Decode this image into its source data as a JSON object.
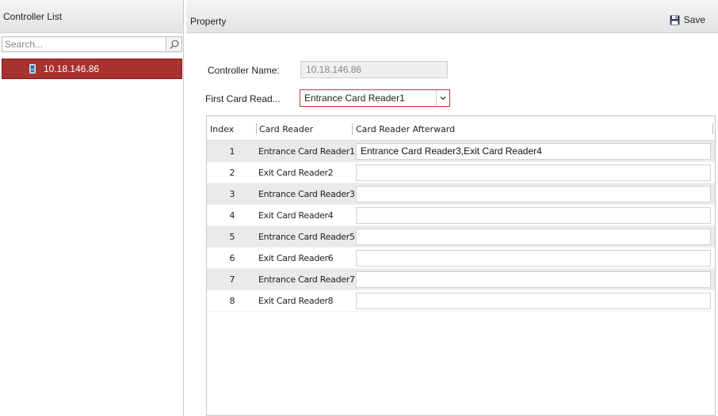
{
  "left_panel": {
    "title": "Controller List",
    "search": {
      "placeholder": "Search...",
      "value": ""
    },
    "tree": [
      {
        "label": "10.18.146.86",
        "icon": "controller-icon",
        "selected": true
      }
    ]
  },
  "property": {
    "title": "Property",
    "save_label": "Save",
    "controller_name_label": "Controller Name:",
    "controller_name_value": "10.18.146.86",
    "first_reader_label": "First Card Read...",
    "first_reader_value": "Entrance Card Reader1"
  },
  "table": {
    "headers": [
      "Index",
      "Card Reader",
      "Card Reader Afterward"
    ],
    "rows": [
      {
        "index": "1",
        "reader": "Entrance Card Reader1",
        "afterward": "Entrance Card Reader3,Exit Card Reader4"
      },
      {
        "index": "2",
        "reader": "Exit Card Reader2",
        "afterward": ""
      },
      {
        "index": "3",
        "reader": "Entrance Card Reader3",
        "afterward": ""
      },
      {
        "index": "4",
        "reader": "Exit Card Reader4",
        "afterward": ""
      },
      {
        "index": "5",
        "reader": "Entrance Card Reader5",
        "afterward": ""
      },
      {
        "index": "6",
        "reader": "Exit Card Reader6",
        "afterward": ""
      },
      {
        "index": "7",
        "reader": "Entrance Card Reader7",
        "afterward": ""
      },
      {
        "index": "8",
        "reader": "Exit Card Reader8",
        "afterward": ""
      }
    ]
  },
  "colors": {
    "selection": "#a8322f",
    "select_border": "#c63b3b",
    "alt_row": "#eaeaea"
  }
}
